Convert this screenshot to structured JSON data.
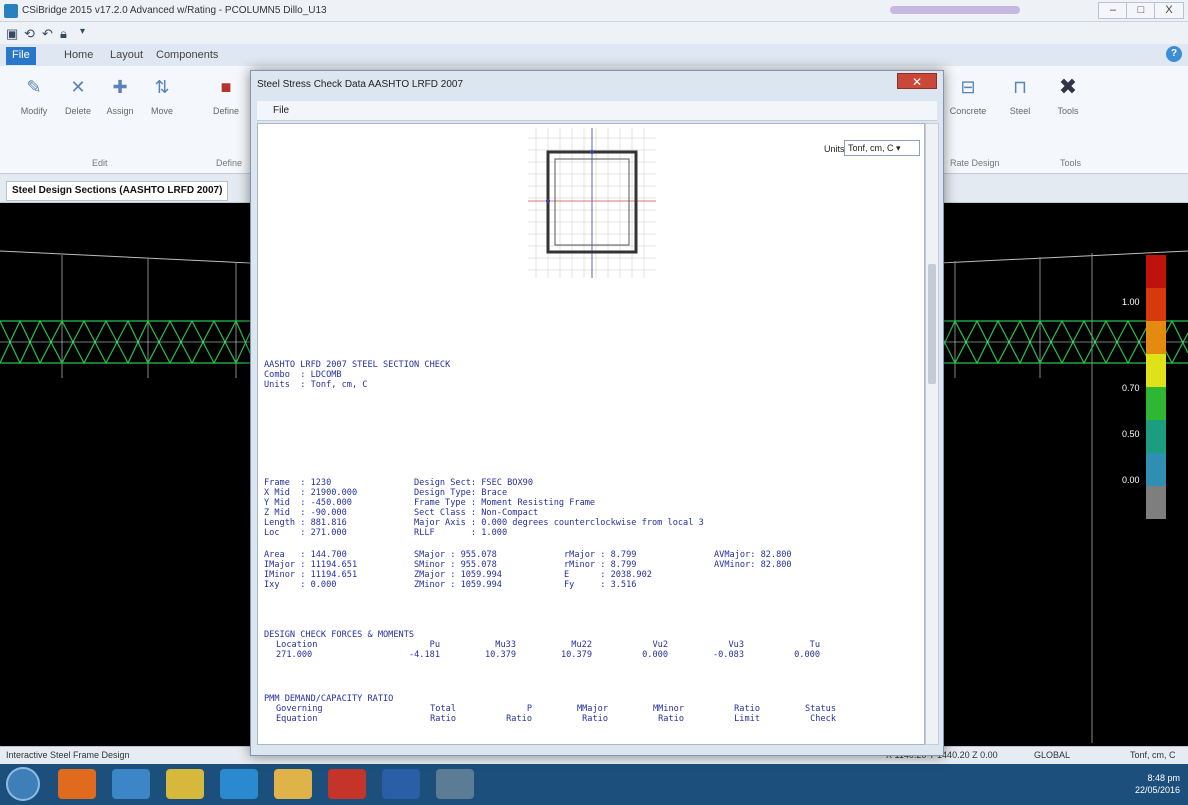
{
  "window": {
    "title": "CSiBridge 2015 v17.2.0 Advanced w/Rating - PCOLUMN5 Dillo_U13",
    "min": "–",
    "max": "□",
    "close": "X"
  },
  "ribbon": {
    "tabs": [
      "File",
      "Home",
      "Layout",
      "Components"
    ],
    "buttons": [
      "Modify",
      "Delete",
      "Assign",
      "Move",
      "Define",
      "Concrete",
      "Steel",
      "Tools"
    ],
    "groups": [
      "Edit",
      "Define",
      "Rate Design",
      "Tools"
    ]
  },
  "doc_tab": "Steel Design Sections (AASHTO LRFD 2007)",
  "legend": {
    "colors": [
      "#c0120c",
      "#d8390c",
      "#e48a10",
      "#dfe219",
      "#2fb734",
      "#1b9e7f",
      "#2f8fb2",
      "#7e7e7e"
    ],
    "values": [
      "1.00",
      "0.70",
      "0.50",
      "0.00"
    ]
  },
  "status": {
    "left": "Interactive Steel Frame Design",
    "coords": "X 1140.20 Y 1440.20 Z 0.00",
    "coord_system": "GLOBAL",
    "units": "Tonf, cm, C"
  },
  "taskbar": {
    "time": "8:48 pm",
    "date": "22/05/2016"
  },
  "dialog": {
    "title": "Steel Stress Check Data AASHTO LRFD 2007",
    "menu_file": "File",
    "units_label": "Units",
    "units_value": "Tonf, cm, C",
    "header": [
      "AASHTO LRFD 2007 STEEL SECTION CHECK",
      "Combo  : LDCOMB",
      "Units  : Tonf, cm, C"
    ],
    "frame_info": [
      [
        "Frame  : 1230",
        "Design Sect: FSEC BOX90"
      ],
      [
        "X Mid  : 21900.000",
        "Design Type: Brace"
      ],
      [
        "Y Mid  : -450.000",
        "Frame Type : Moment Resisting Frame"
      ],
      [
        "Z Mid  : -90.000",
        "Sect Class : Non-Compact"
      ],
      [
        "Length : 881.816",
        "Major Axis : 0.000 degrees counterclockwise from local 3"
      ],
      [
        "Loc    : 271.000",
        "RLLF       : 1.000"
      ]
    ],
    "props": [
      [
        "Area   : 144.700",
        "SMajor : 955.078",
        "rMajor : 8.799",
        "AVMajor: 82.800"
      ],
      [
        "IMajor : 11194.651",
        "SMinor : 955.078",
        "rMinor : 8.799",
        "AVMinor: 82.800"
      ],
      [
        "IMinor : 11194.651",
        "ZMajor : 1059.994",
        "E      : 2038.902",
        ""
      ],
      [
        "Ixy    : 0.000",
        "ZMinor : 1059.994",
        "Fy     : 3.516",
        ""
      ]
    ],
    "forces_title": "DESIGN CHECK FORCES & MOMENTS",
    "forces_headers": [
      "Location",
      "Pu",
      "Mu33",
      "Mu22",
      "Vu2",
      "Vu3",
      "Tu"
    ],
    "forces_values": [
      "271.000",
      "-4.181",
      "10.379",
      "10.379",
      "0.000",
      "-0.083",
      "0.000"
    ],
    "dcr_title": "PMM DEMAND/CAPACITY RATIO",
    "dcr_headers1": [
      "Governing",
      "Total",
      "P",
      "MMajor",
      "MMinor",
      "Ratio",
      "Status"
    ],
    "dcr_headers2": [
      "Equation",
      "Ratio",
      "Ratio",
      "Ratio",
      "Ratio",
      "Limit",
      "Check"
    ]
  }
}
